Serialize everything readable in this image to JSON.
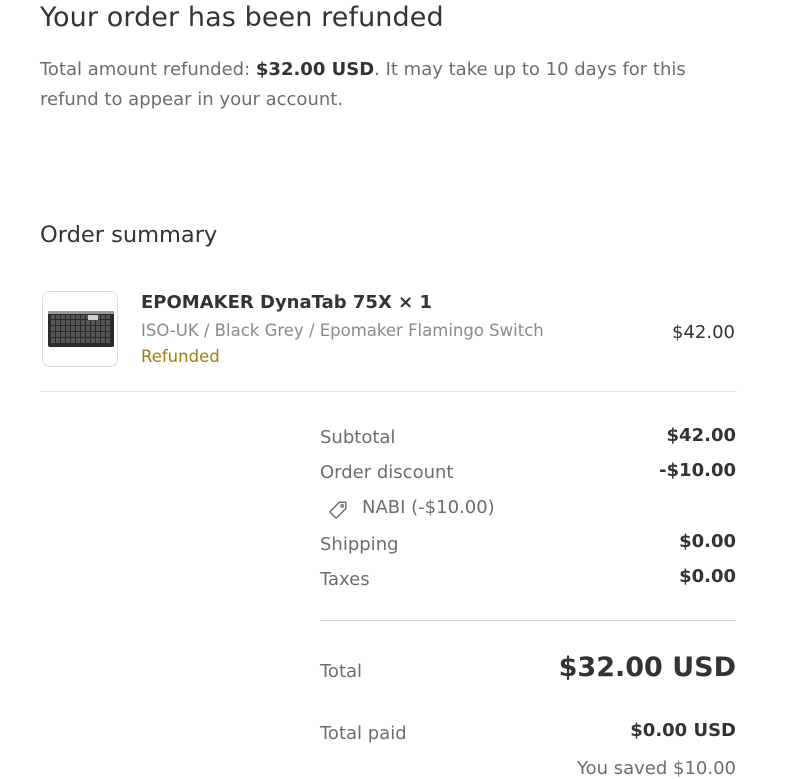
{
  "page": {
    "heading": "Your order has been refunded",
    "refund_message": {
      "prefix": "Total amount refunded: ",
      "amount": "$32.00 USD",
      "suffix": ". It may take up to 10 days for this refund to appear in your account."
    }
  },
  "order_summary": {
    "title": "Order summary",
    "items": [
      {
        "name": "EPOMAKER DynaTab 75X × 1",
        "variant": "ISO-UK / Black Grey / Epomaker Flamingo Switch",
        "status": "Refunded",
        "price": "$42.00",
        "image_icon": "keyboard-product-image"
      }
    ],
    "subtotal": {
      "label": "Subtotal",
      "value": "$42.00"
    },
    "order_discount": {
      "label": "Order discount",
      "value": "-$10.00",
      "code": "NABI (-$10.00)",
      "icon": "tag-icon"
    },
    "shipping": {
      "label": "Shipping",
      "value": "$0.00"
    },
    "taxes": {
      "label": "Taxes",
      "value": "$0.00"
    },
    "total": {
      "label": "Total",
      "value": "$32.00 USD"
    },
    "total_paid": {
      "label": "Total paid",
      "value": "$0.00 USD"
    },
    "savings": "You saved $10.00"
  },
  "colors": {
    "text_primary": "#333333",
    "text_secondary": "#6d6d6d",
    "refunded_status": "#a07e0a",
    "divider": "#e3e3e3"
  }
}
